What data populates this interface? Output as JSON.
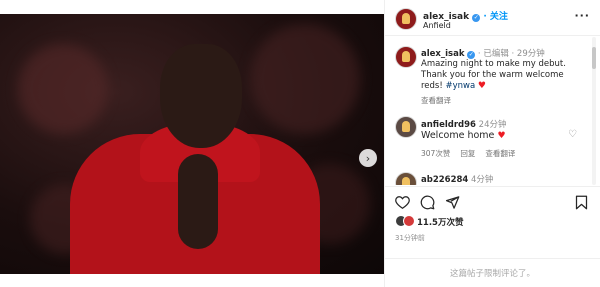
{
  "post": {
    "username": "alex_isak",
    "follow_label": "关注",
    "location": "Anfield",
    "more_label": "···",
    "carousel": {
      "slides": 4,
      "active_slide": 1,
      "next_label": "›"
    }
  },
  "caption": {
    "username": "alex_isak",
    "meta": "· 已编辑 · 29分钟",
    "text": "Amazing night to make my debut. Thank you for the warm welcome reds! ",
    "hashtag": "#ynwa",
    "heart": "♥",
    "translate_label": "查看翻译"
  },
  "comments": [
    {
      "username": "anfieldrd96",
      "time": "24分钟",
      "text": "Welcome home ",
      "heart": "♥",
      "likes": "307次赞",
      "reply_label": "回复",
      "translate_label": "查看翻译"
    },
    {
      "username": "ab226284",
      "time": "4分钟"
    }
  ],
  "engagement": {
    "likes": "11.5万次赞",
    "time_ago": "31分钟前"
  },
  "footer": {
    "notice": "这篇帖子限制评论了。"
  },
  "icons": {
    "like": "heart-outline-icon",
    "comment": "comment-bubble-icon",
    "share": "paper-plane-icon",
    "save": "bookmark-icon"
  },
  "colors": {
    "accent_blue": "#0095f6",
    "verified_blue": "#3897f0",
    "heart_red": "#ed1c24",
    "hashtag": "#00376b",
    "muted": "#8e8e8e"
  }
}
